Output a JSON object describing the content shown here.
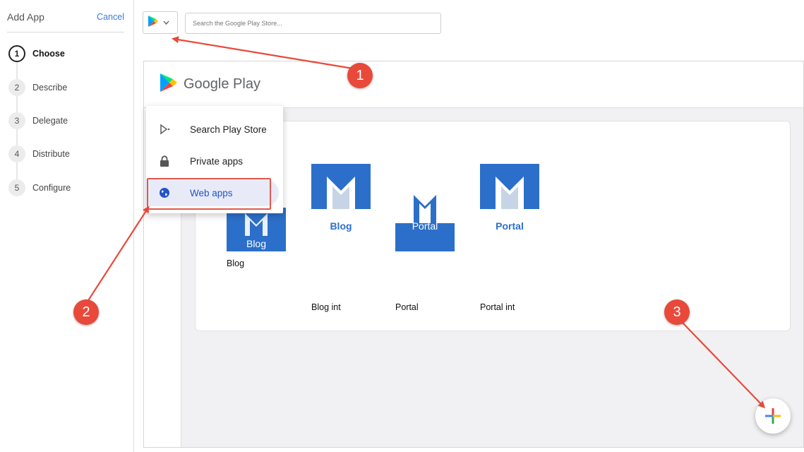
{
  "wizard": {
    "title": "Add App",
    "cancel_label": "Cancel",
    "steps": [
      {
        "num": "1",
        "label": "Choose"
      },
      {
        "num": "2",
        "label": "Describe"
      },
      {
        "num": "3",
        "label": "Delegate"
      },
      {
        "num": "4",
        "label": "Distribute"
      },
      {
        "num": "5",
        "label": "Configure"
      }
    ]
  },
  "toolbar": {
    "store_icon": "google-play-icon",
    "search_placeholder": "Search the Google Play Store..."
  },
  "google_play": {
    "title": "Google Play"
  },
  "menu": {
    "items": [
      {
        "label": "Search Play Store",
        "icon": "play-store-icon"
      },
      {
        "label": "Private apps",
        "icon": "lock-icon"
      },
      {
        "label": "Web apps",
        "icon": "globe-icon",
        "selected": true
      }
    ]
  },
  "apps": [
    {
      "name": "Blog",
      "tile_text": "Blog"
    },
    {
      "name": "Blog int",
      "tile_text": "Blog"
    },
    {
      "name": "Portal",
      "tile_text": "Portal"
    },
    {
      "name": "Portal int",
      "tile_text": "Portal"
    }
  ],
  "fab": {
    "icon": "plus-icon"
  },
  "annotations": {
    "badges": [
      "1",
      "2",
      "3"
    ],
    "color": "#e8493a"
  },
  "colors": {
    "accent": "#3a7bd5",
    "tile_blue": "#2c6fca",
    "selected_text": "#2454c7"
  }
}
